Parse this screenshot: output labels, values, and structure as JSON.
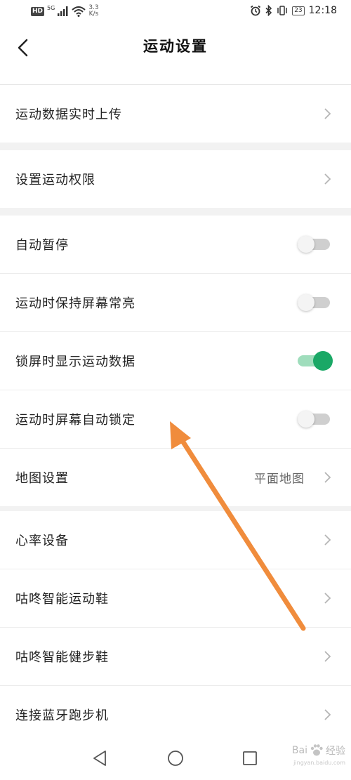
{
  "status_bar": {
    "hd": "HD",
    "network": "5G",
    "speed_value": "3.3",
    "speed_unit": "K/s",
    "battery": "23",
    "time": "12:18"
  },
  "header": {
    "title": "运动设置"
  },
  "groups": {
    "g1": {
      "upload": "运动数据实时上传"
    },
    "g2": {
      "permission": "设置运动权限"
    },
    "g3": {
      "auto_pause": "自动暂停",
      "auto_pause_on": false,
      "screen_on": "运动时保持屏幕常亮",
      "screen_on_on": false,
      "lock_show": "锁屏时显示运动数据",
      "lock_show_on": true,
      "auto_lock": "运动时屏幕自动锁定",
      "auto_lock_on": false,
      "map": "地图设置",
      "map_value": "平面地图"
    },
    "g4": {
      "heart_rate": "心率设备",
      "sport_shoes": "咕咚智能运动鞋",
      "walking_shoes": "咕咚智能健步鞋",
      "treadmill": "连接蓝牙跑步机"
    }
  },
  "watermark": {
    "brand": "Bai",
    "brand2": "经验",
    "sub": "jingyan.baidu.com"
  },
  "colors": {
    "accent_green": "#1aa866",
    "annotation_arrow": "#f08c3c"
  }
}
